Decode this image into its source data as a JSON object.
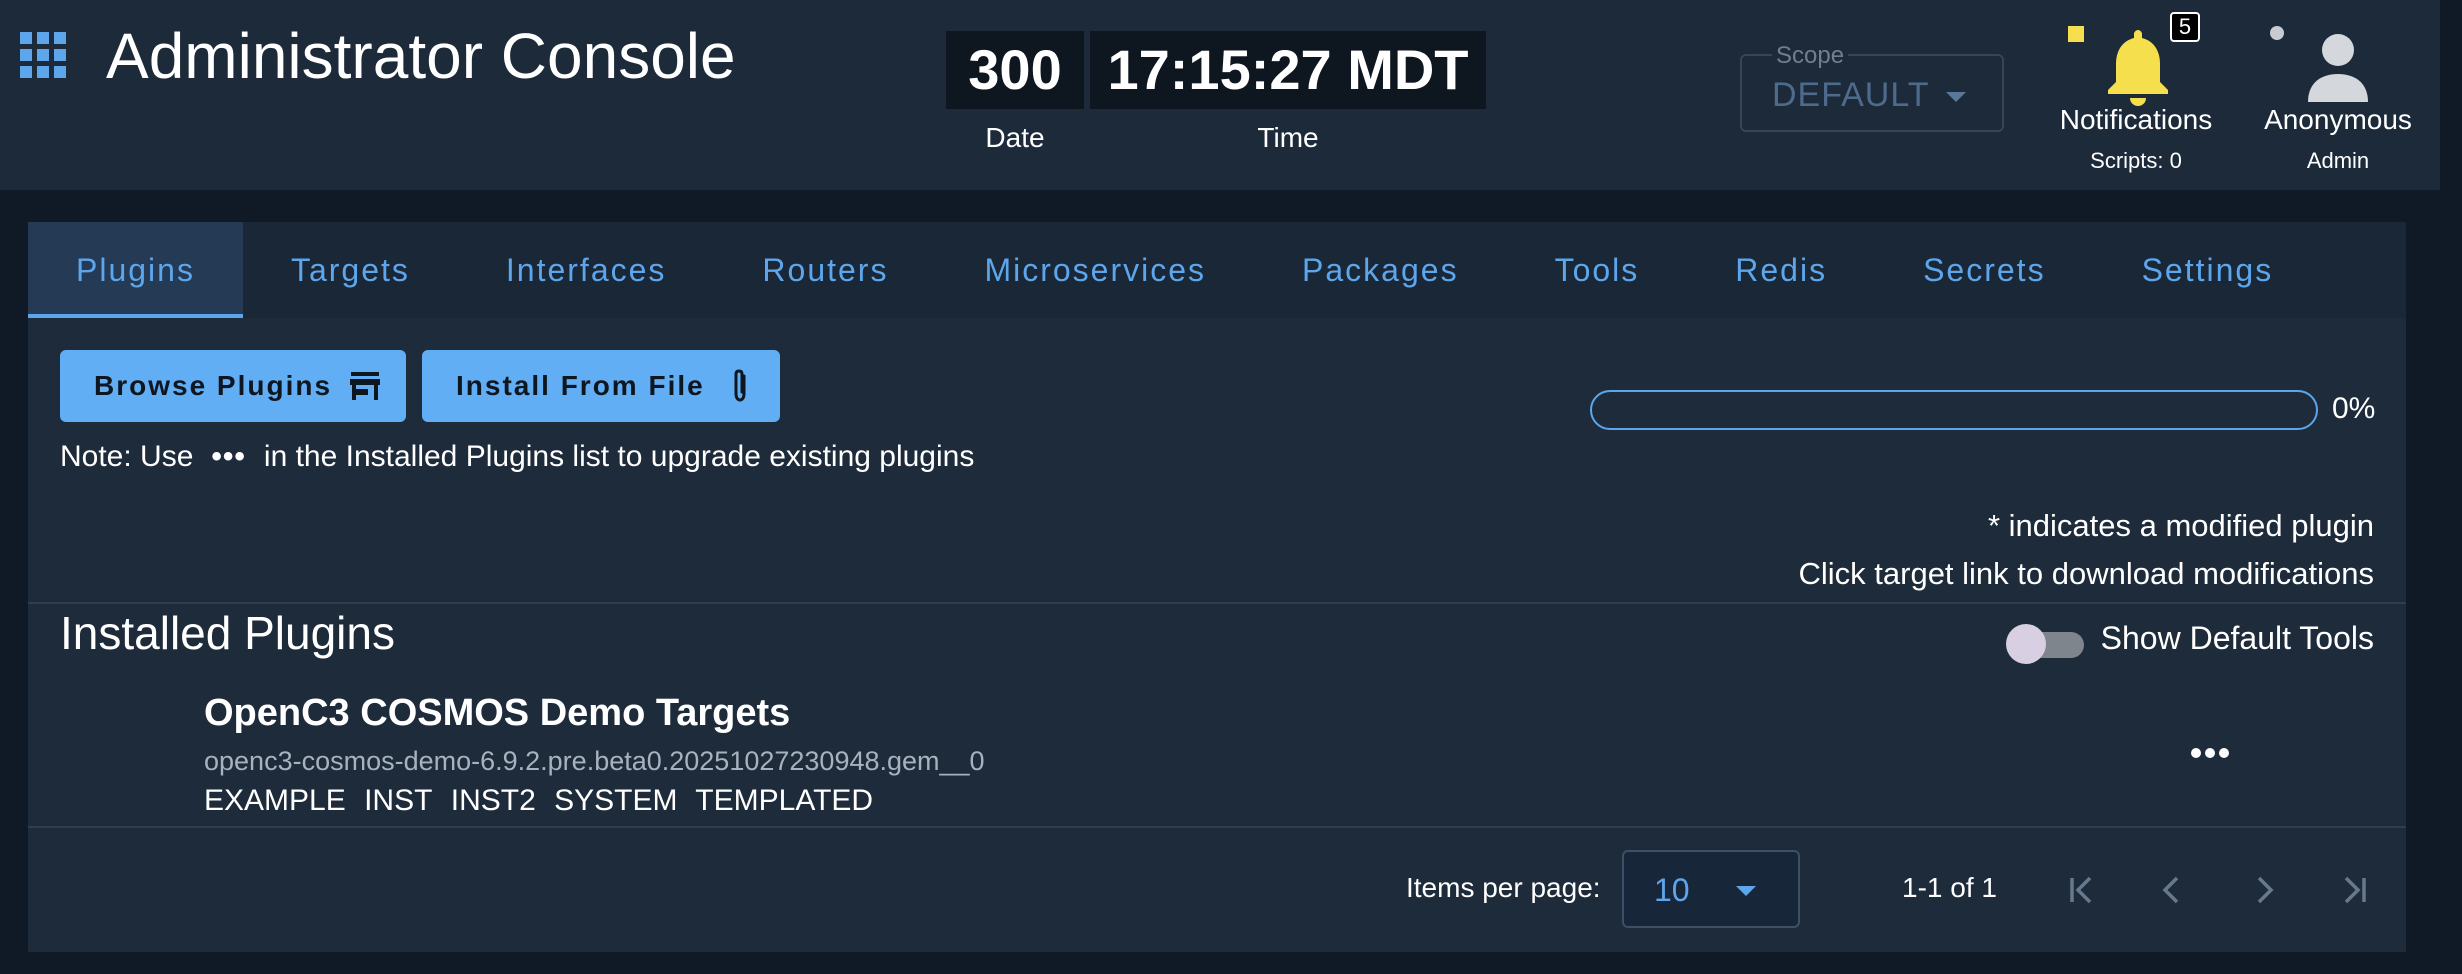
{
  "header": {
    "title": "Administrator Console",
    "clock": {
      "date_value": "300",
      "time_value": "17:15:27 MDT",
      "date_label": "Date",
      "time_label": "Time"
    },
    "scope": {
      "label": "Scope",
      "value": "DEFAULT"
    },
    "notifications": {
      "label": "Notifications",
      "badge_count": "5",
      "scripts": "Scripts: 0"
    },
    "user": {
      "name": "Anonymous",
      "role": "Admin"
    }
  },
  "tabs": [
    {
      "label": "Plugins",
      "active": true
    },
    {
      "label": "Targets"
    },
    {
      "label": "Interfaces"
    },
    {
      "label": "Routers"
    },
    {
      "label": "Microservices"
    },
    {
      "label": "Packages"
    },
    {
      "label": "Tools"
    },
    {
      "label": "Redis"
    },
    {
      "label": "Secrets"
    },
    {
      "label": "Settings"
    }
  ],
  "actions": {
    "browse_label": "Browse Plugins",
    "install_label": "Install From File",
    "note_prefix": "Note: Use",
    "note_dots": "•••",
    "note_suffix": "in the Installed Plugins list to upgrade existing plugins"
  },
  "progress": {
    "value_percent": 0,
    "text": "0%"
  },
  "info": {
    "modified_note": "* indicates a modified plugin",
    "download_note": "Click target link to download modifications"
  },
  "installed": {
    "title": "Installed Plugins",
    "toggle_label": "Show Default Tools",
    "toggle_on": false,
    "plugins": [
      {
        "name": "OpenC3 COSMOS Demo Targets",
        "gem": "openc3-cosmos-demo-6.9.2.pre.beta0.20251027230948.gem__0",
        "targets": [
          "EXAMPLE",
          "INST",
          "INST2",
          "SYSTEM",
          "TEMPLATED"
        ]
      }
    ]
  },
  "pagination": {
    "items_per_page_label": "Items per page:",
    "items_per_page_value": "10",
    "range": "1-1 of 1"
  },
  "colors": {
    "accent": "#5da6ec",
    "button": "#62aef5",
    "app_bar": "#1c2a3a",
    "notif_indicator": "#f5df4d",
    "bell": "#f5df4d"
  },
  "icons": {
    "apps": "grid-icon",
    "browse": "store-icon",
    "install": "paperclip-icon",
    "notifications": "bell-icon",
    "user": "account-icon",
    "more": "dots-horizontal-icon",
    "first": "first-page-icon",
    "prev": "chevron-left-icon",
    "next": "chevron-right-icon",
    "last": "last-page-icon"
  }
}
